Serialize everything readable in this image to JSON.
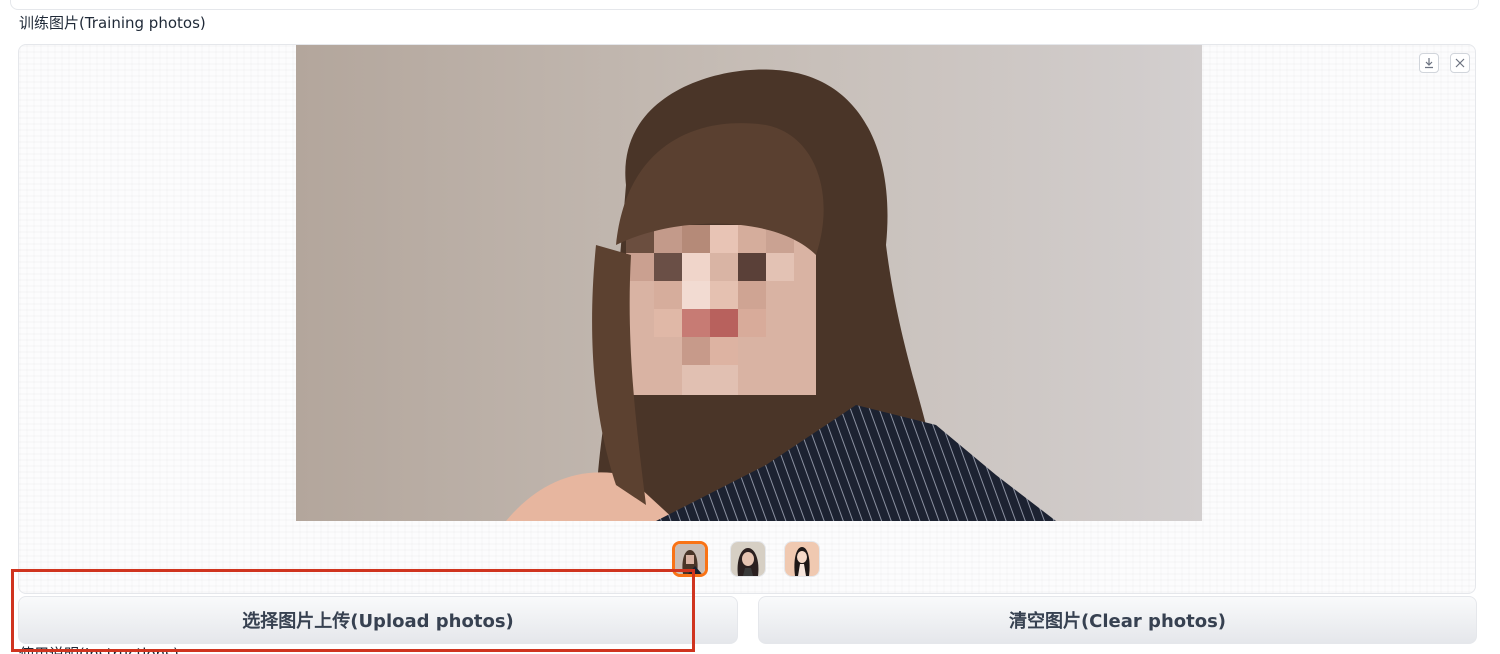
{
  "section": {
    "label": "训练图片(Training photos)"
  },
  "gallery": {
    "download_icon": "download-icon",
    "close_icon": "close-icon",
    "thumbnails": [
      "photo-1",
      "photo-2",
      "photo-3"
    ],
    "selected_index": 0,
    "accent": "#f97316"
  },
  "actions": {
    "upload_label": "选择图片上传(Upload photos)",
    "clear_label": "清空图片(Clear photos)"
  },
  "annotation": {
    "color": "#d0341f"
  },
  "next_section": {
    "label": "使用说明(Instructions)"
  }
}
